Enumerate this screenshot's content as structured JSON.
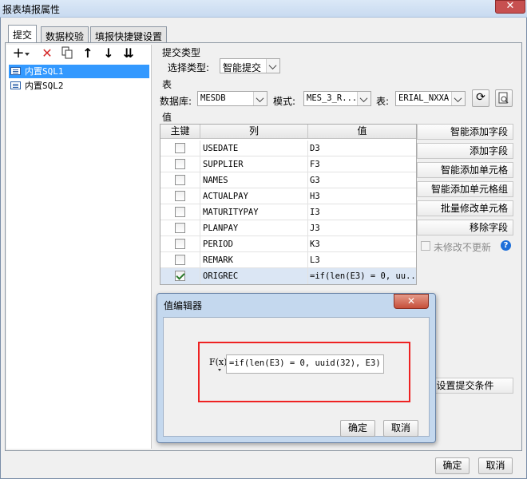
{
  "window": {
    "title": "报表填报属性"
  },
  "tabs": [
    "提交",
    "数据校验",
    "填报快捷键设置"
  ],
  "tree": {
    "items": [
      "内置SQL1",
      "内置SQL2"
    ]
  },
  "submit_type": {
    "section": "提交类型",
    "label": "选择类型:",
    "value": "智能提交"
  },
  "table_section": {
    "section": "表",
    "db_label": "数据库:",
    "db_value": "MESDB",
    "mode_label": "模式:",
    "mode_value": "MES_3_R...",
    "table_label": "表:",
    "table_value": "ERIAL_NXXA"
  },
  "values_section": {
    "section": "值",
    "headers": [
      "主键",
      "列",
      "值"
    ],
    "rows": [
      {
        "key": false,
        "column": "USEDATE",
        "value": "D3"
      },
      {
        "key": false,
        "column": "SUPPLIER",
        "value": "F3"
      },
      {
        "key": false,
        "column": "NAMES",
        "value": "G3"
      },
      {
        "key": false,
        "column": "ACTUALPAY",
        "value": "H3"
      },
      {
        "key": false,
        "column": "MATURITYPAY",
        "value": "I3"
      },
      {
        "key": false,
        "column": "PLANPAY",
        "value": "J3"
      },
      {
        "key": false,
        "column": "PERIOD",
        "value": "K3"
      },
      {
        "key": false,
        "column": "REMARK",
        "value": "L3"
      },
      {
        "key": true,
        "column": "ORIGREC",
        "value": "=if(len(E3) = 0, uu..."
      }
    ]
  },
  "right_buttons": [
    "智能添加字段",
    "添加字段",
    "智能添加单元格",
    "智能添加单元格组",
    "批量修改单元格",
    "移除字段"
  ],
  "no_update_label": "未修改不更新",
  "condition_button": "设置提交条件",
  "footer": {
    "ok": "确定",
    "cancel": "取消"
  },
  "dialog": {
    "title": "值编辑器",
    "formula_icon": "F(x)",
    "formula": "=if(len(E3) = 0, uuid(32), E3)",
    "ok": "确定",
    "cancel": "取消"
  },
  "colors": {
    "selection": "#3399ff",
    "highlight_box": "#e22222",
    "help": "#1e6fd9",
    "delete": "#d62a2a"
  }
}
